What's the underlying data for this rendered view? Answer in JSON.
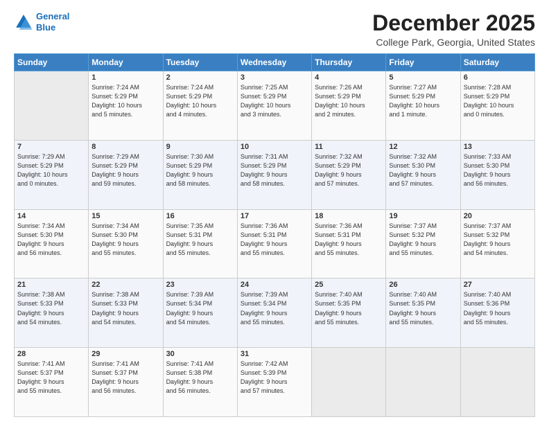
{
  "header": {
    "logo_line1": "General",
    "logo_line2": "Blue",
    "title": "December 2025",
    "subtitle": "College Park, Georgia, United States"
  },
  "days_of_week": [
    "Sunday",
    "Monday",
    "Tuesday",
    "Wednesday",
    "Thursday",
    "Friday",
    "Saturday"
  ],
  "weeks": [
    [
      {
        "num": "",
        "info": ""
      },
      {
        "num": "1",
        "info": "Sunrise: 7:24 AM\nSunset: 5:29 PM\nDaylight: 10 hours\nand 5 minutes."
      },
      {
        "num": "2",
        "info": "Sunrise: 7:24 AM\nSunset: 5:29 PM\nDaylight: 10 hours\nand 4 minutes."
      },
      {
        "num": "3",
        "info": "Sunrise: 7:25 AM\nSunset: 5:29 PM\nDaylight: 10 hours\nand 3 minutes."
      },
      {
        "num": "4",
        "info": "Sunrise: 7:26 AM\nSunset: 5:29 PM\nDaylight: 10 hours\nand 2 minutes."
      },
      {
        "num": "5",
        "info": "Sunrise: 7:27 AM\nSunset: 5:29 PM\nDaylight: 10 hours\nand 1 minute."
      },
      {
        "num": "6",
        "info": "Sunrise: 7:28 AM\nSunset: 5:29 PM\nDaylight: 10 hours\nand 0 minutes."
      }
    ],
    [
      {
        "num": "7",
        "info": "Sunrise: 7:29 AM\nSunset: 5:29 PM\nDaylight: 10 hours\nand 0 minutes."
      },
      {
        "num": "8",
        "info": "Sunrise: 7:29 AM\nSunset: 5:29 PM\nDaylight: 9 hours\nand 59 minutes."
      },
      {
        "num": "9",
        "info": "Sunrise: 7:30 AM\nSunset: 5:29 PM\nDaylight: 9 hours\nand 58 minutes."
      },
      {
        "num": "10",
        "info": "Sunrise: 7:31 AM\nSunset: 5:29 PM\nDaylight: 9 hours\nand 58 minutes."
      },
      {
        "num": "11",
        "info": "Sunrise: 7:32 AM\nSunset: 5:29 PM\nDaylight: 9 hours\nand 57 minutes."
      },
      {
        "num": "12",
        "info": "Sunrise: 7:32 AM\nSunset: 5:30 PM\nDaylight: 9 hours\nand 57 minutes."
      },
      {
        "num": "13",
        "info": "Sunrise: 7:33 AM\nSunset: 5:30 PM\nDaylight: 9 hours\nand 56 minutes."
      }
    ],
    [
      {
        "num": "14",
        "info": "Sunrise: 7:34 AM\nSunset: 5:30 PM\nDaylight: 9 hours\nand 56 minutes."
      },
      {
        "num": "15",
        "info": "Sunrise: 7:34 AM\nSunset: 5:30 PM\nDaylight: 9 hours\nand 55 minutes."
      },
      {
        "num": "16",
        "info": "Sunrise: 7:35 AM\nSunset: 5:31 PM\nDaylight: 9 hours\nand 55 minutes."
      },
      {
        "num": "17",
        "info": "Sunrise: 7:36 AM\nSunset: 5:31 PM\nDaylight: 9 hours\nand 55 minutes."
      },
      {
        "num": "18",
        "info": "Sunrise: 7:36 AM\nSunset: 5:31 PM\nDaylight: 9 hours\nand 55 minutes."
      },
      {
        "num": "19",
        "info": "Sunrise: 7:37 AM\nSunset: 5:32 PM\nDaylight: 9 hours\nand 55 minutes."
      },
      {
        "num": "20",
        "info": "Sunrise: 7:37 AM\nSunset: 5:32 PM\nDaylight: 9 hours\nand 54 minutes."
      }
    ],
    [
      {
        "num": "21",
        "info": "Sunrise: 7:38 AM\nSunset: 5:33 PM\nDaylight: 9 hours\nand 54 minutes."
      },
      {
        "num": "22",
        "info": "Sunrise: 7:38 AM\nSunset: 5:33 PM\nDaylight: 9 hours\nand 54 minutes."
      },
      {
        "num": "23",
        "info": "Sunrise: 7:39 AM\nSunset: 5:34 PM\nDaylight: 9 hours\nand 54 minutes."
      },
      {
        "num": "24",
        "info": "Sunrise: 7:39 AM\nSunset: 5:34 PM\nDaylight: 9 hours\nand 55 minutes."
      },
      {
        "num": "25",
        "info": "Sunrise: 7:40 AM\nSunset: 5:35 PM\nDaylight: 9 hours\nand 55 minutes."
      },
      {
        "num": "26",
        "info": "Sunrise: 7:40 AM\nSunset: 5:35 PM\nDaylight: 9 hours\nand 55 minutes."
      },
      {
        "num": "27",
        "info": "Sunrise: 7:40 AM\nSunset: 5:36 PM\nDaylight: 9 hours\nand 55 minutes."
      }
    ],
    [
      {
        "num": "28",
        "info": "Sunrise: 7:41 AM\nSunset: 5:37 PM\nDaylight: 9 hours\nand 55 minutes."
      },
      {
        "num": "29",
        "info": "Sunrise: 7:41 AM\nSunset: 5:37 PM\nDaylight: 9 hours\nand 56 minutes."
      },
      {
        "num": "30",
        "info": "Sunrise: 7:41 AM\nSunset: 5:38 PM\nDaylight: 9 hours\nand 56 minutes."
      },
      {
        "num": "31",
        "info": "Sunrise: 7:42 AM\nSunset: 5:39 PM\nDaylight: 9 hours\nand 57 minutes."
      },
      {
        "num": "",
        "info": ""
      },
      {
        "num": "",
        "info": ""
      },
      {
        "num": "",
        "info": ""
      }
    ]
  ]
}
